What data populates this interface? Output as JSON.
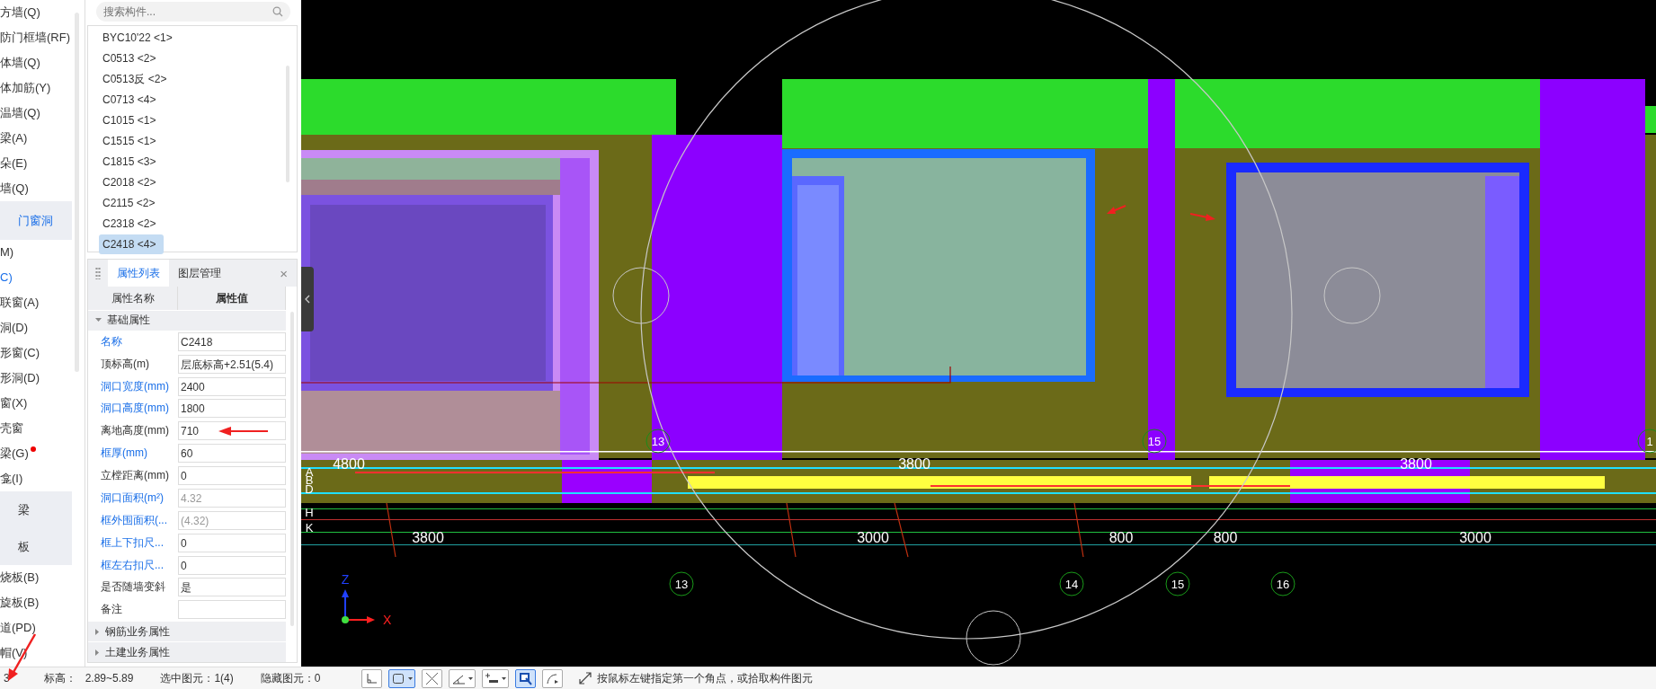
{
  "sidebar": {
    "items": [
      {
        "kind": "item",
        "label": "方墙(Q)",
        "selected": false,
        "marked": false
      },
      {
        "kind": "item",
        "label": "防门框墙(RF)",
        "selected": false,
        "marked": false
      },
      {
        "kind": "item",
        "label": "体墙(Q)",
        "selected": false,
        "marked": false
      },
      {
        "kind": "item",
        "label": "体加筋(Y)",
        "selected": false,
        "marked": false
      },
      {
        "kind": "item",
        "label": "温墙(Q)",
        "selected": false,
        "marked": false
      },
      {
        "kind": "item",
        "label": "梁(A)",
        "selected": false,
        "marked": false
      },
      {
        "kind": "item",
        "label": "朵(E)",
        "selected": false,
        "marked": false
      },
      {
        "kind": "item",
        "label": "墙(Q)",
        "selected": false,
        "marked": false
      },
      {
        "kind": "group",
        "label": "门窗洞",
        "selected": true,
        "marked": false
      },
      {
        "kind": "item",
        "label": "M)",
        "selected": false,
        "marked": false
      },
      {
        "kind": "item",
        "label": "C)",
        "selected": true,
        "marked": false
      },
      {
        "kind": "item",
        "label": "联窗(A)",
        "selected": false,
        "marked": false
      },
      {
        "kind": "item",
        "label": "洞(D)",
        "selected": false,
        "marked": false
      },
      {
        "kind": "item",
        "label": "形窗(C)",
        "selected": false,
        "marked": false
      },
      {
        "kind": "item",
        "label": "形洞(D)",
        "selected": false,
        "marked": false
      },
      {
        "kind": "item",
        "label": "窗(X)",
        "selected": false,
        "marked": false
      },
      {
        "kind": "item",
        "label": "壳窗",
        "selected": false,
        "marked": false
      },
      {
        "kind": "item",
        "label": "梁(G)",
        "selected": false,
        "marked": true
      },
      {
        "kind": "item",
        "label": "龛(I)",
        "selected": false,
        "marked": false
      },
      {
        "kind": "group",
        "label": "梁",
        "selected": false,
        "marked": false
      },
      {
        "kind": "group",
        "label": "板",
        "selected": false,
        "marked": false
      },
      {
        "kind": "item",
        "label": "烧板(B)",
        "selected": false,
        "marked": false
      },
      {
        "kind": "item",
        "label": "旋板(B)",
        "selected": false,
        "marked": false
      },
      {
        "kind": "item",
        "label": "道(PD)",
        "selected": false,
        "marked": false
      },
      {
        "kind": "item",
        "label": "帽(V)",
        "selected": false,
        "marked": false
      }
    ]
  },
  "components": {
    "search": {
      "placeholder": "搜索构件..."
    },
    "items": [
      {
        "label": "BYC10'22 <1>",
        "selected": false
      },
      {
        "label": "C0513 <2>",
        "selected": false
      },
      {
        "label": "C0513反 <2>",
        "selected": false
      },
      {
        "label": "C0713 <4>",
        "selected": false
      },
      {
        "label": "C1015 <1>",
        "selected": false
      },
      {
        "label": "C1515 <1>",
        "selected": false
      },
      {
        "label": "C1815 <3>",
        "selected": false
      },
      {
        "label": "C2018 <2>",
        "selected": false
      },
      {
        "label": "C2115 <2>",
        "selected": false
      },
      {
        "label": "C2318 <2>",
        "selected": false
      },
      {
        "label": "C2418 <4>",
        "selected": true
      }
    ]
  },
  "properties": {
    "tabs": [
      {
        "label": "属性列表",
        "selected": true
      },
      {
        "label": "图层管理",
        "selected": false
      }
    ],
    "close": "×",
    "columns": [
      "属性名称",
      "属性值"
    ],
    "sections": [
      {
        "title": "基础属性",
        "expanded": true,
        "rows": [
          {
            "name": "名称",
            "kind": "public",
            "value": "C2418",
            "disabled": false
          },
          {
            "name": "顶标高(m)",
            "kind": "private",
            "value": "层底标高+2.51(5.4)",
            "disabled": false
          },
          {
            "name": "洞口宽度(mm)",
            "kind": "public",
            "value": "2400",
            "disabled": false
          },
          {
            "name": "洞口高度(mm)",
            "kind": "public",
            "value": "1800",
            "disabled": false
          },
          {
            "name": "离地高度(mm)",
            "kind": "private",
            "value": "710",
            "disabled": false
          },
          {
            "name": "框厚(mm)",
            "kind": "public",
            "value": "60",
            "disabled": false
          },
          {
            "name": "立樘距离(mm)",
            "kind": "private",
            "value": "0",
            "disabled": false
          },
          {
            "name": "洞口面积(m²)",
            "kind": "public",
            "value": "4.32",
            "disabled": true
          },
          {
            "name": "框外围面积(...",
            "kind": "public",
            "value": "(4.32)",
            "disabled": true
          },
          {
            "name": "框上下扣尺...",
            "kind": "public",
            "value": "0",
            "disabled": false
          },
          {
            "name": "框左右扣尺...",
            "kind": "public",
            "value": "0",
            "disabled": false
          },
          {
            "name": "是否随墙变斜",
            "kind": "private",
            "value": "是",
            "disabled": false
          },
          {
            "name": "备注",
            "kind": "private",
            "disabled": false
          }
        ]
      },
      {
        "title": "钢筋业务属性",
        "expanded": false
      },
      {
        "title": "土建业务属性",
        "expanded": false
      }
    ]
  },
  "canvas": {
    "top_dimensions": [
      "4800",
      "3800",
      "3800"
    ],
    "top_axis_labels": [
      "13",
      "15",
      "1"
    ],
    "row_labels": [
      "A",
      "B",
      "D",
      "H",
      "K"
    ],
    "bottom_dimensions": [
      "3800",
      "3000",
      "800",
      "800",
      "3000"
    ],
    "bottom_axis_labels": [
      "13",
      "14",
      "15",
      "16"
    ],
    "axis": {
      "z": "Z",
      "x": "X"
    }
  },
  "status_bar": {
    "layer": "3",
    "elevation_label": "标高：",
    "elevation": "2.89~5.89",
    "selected": "选中图元：1(4)",
    "hidden": "隐藏图元：0",
    "tools": [
      {
        "kind": "corner",
        "selected": false,
        "dropdown": false
      },
      {
        "kind": "rect",
        "selected": true,
        "dropdown": true
      },
      {
        "kind": "cross",
        "selected": false,
        "dropdown": false
      },
      {
        "kind": "angle",
        "selected": false,
        "dropdown": true
      },
      {
        "kind": "offset",
        "selected": false,
        "dropdown": true
      },
      {
        "kind": "pick",
        "selected": true,
        "dropdown": false
      },
      {
        "kind": "arc",
        "selected": false,
        "dropdown": false
      }
    ],
    "hint": "按鼠标左键指定第一个角点，或拾取构件图元"
  }
}
